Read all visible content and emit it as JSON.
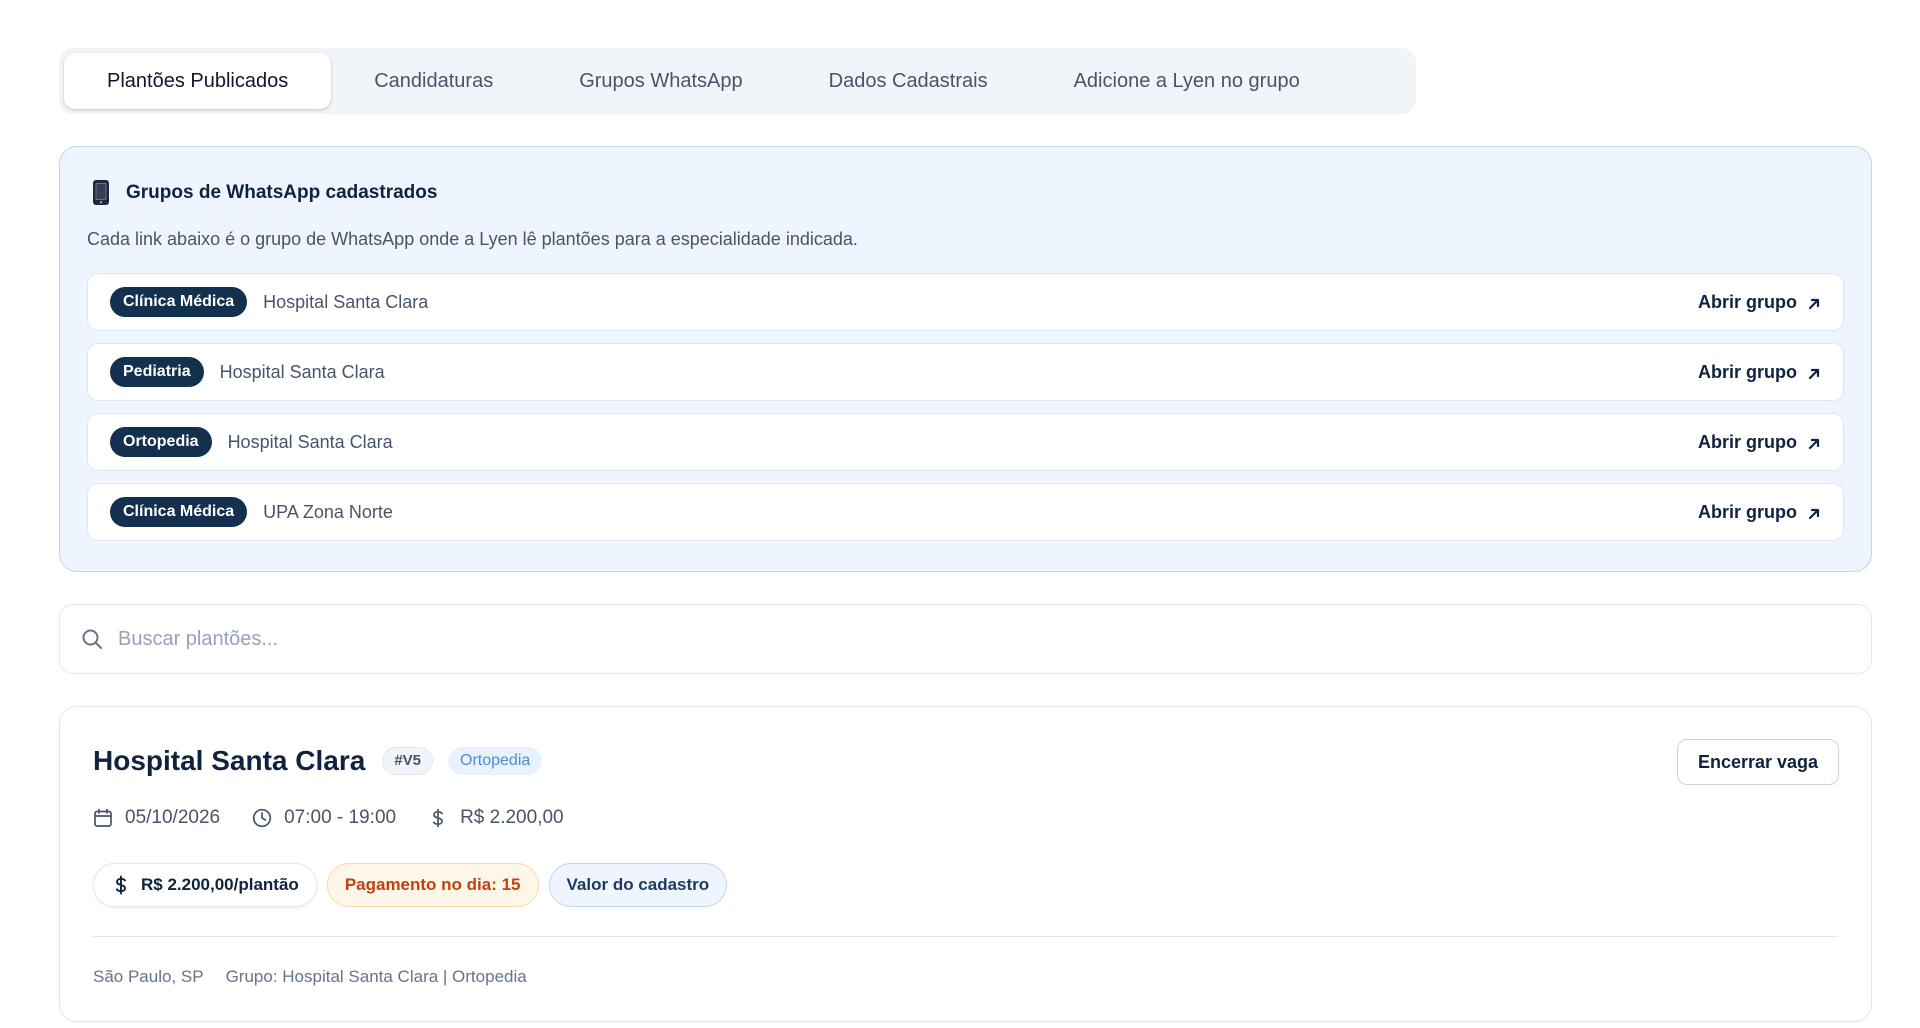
{
  "tabs": [
    {
      "label": "Plantões Publicados",
      "active": true
    },
    {
      "label": "Candidaturas",
      "active": false
    },
    {
      "label": "Grupos WhatsApp",
      "active": false
    },
    {
      "label": "Dados Cadastrais",
      "active": false
    },
    {
      "label": "Adicione a Lyen no grupo",
      "active": false
    }
  ],
  "groups_panel": {
    "icon": "mobile-phone-icon",
    "title": "Grupos de WhatsApp cadastrados",
    "description": "Cada link abaixo é o grupo de WhatsApp onde a Lyen lê plantões para a especialidade indicada.",
    "items": [
      {
        "specialty": "Clínica Médica",
        "name": "Hospital Santa Clara",
        "link_label": "Abrir grupo"
      },
      {
        "specialty": "Pediatria",
        "name": "Hospital Santa Clara",
        "link_label": "Abrir grupo"
      },
      {
        "specialty": "Ortopedia",
        "name": "Hospital Santa Clara",
        "link_label": "Abrir grupo"
      },
      {
        "specialty": "Clínica Médica",
        "name": "UPA Zona Norte",
        "link_label": "Abrir grupo"
      }
    ]
  },
  "search": {
    "placeholder": "Buscar plantões...",
    "value": ""
  },
  "shift": {
    "hospital": "Hospital Santa Clara",
    "id": "#V5",
    "specialty": "Ortopedia",
    "close_label": "Encerrar vaga",
    "date": "05/10/2026",
    "time": "07:00 - 19:00",
    "amount": "R$ 2.200,00",
    "price_pill": "R$ 2.200,00/plantão",
    "payment_pill": "Pagamento no dia: 15",
    "value_pill": "Valor do cadastro",
    "location": "São Paulo, SP",
    "group": "Grupo: Hospital Santa Clara | Ortopedia"
  },
  "colors": {
    "navy": "#13304f",
    "panel_bg": "#eef5fe",
    "panel_border": "#bcd6f5",
    "payment_text": "#c2410c",
    "payment_bg": "#fff6ea",
    "specialty_tag_text": "#4b8fd6"
  }
}
